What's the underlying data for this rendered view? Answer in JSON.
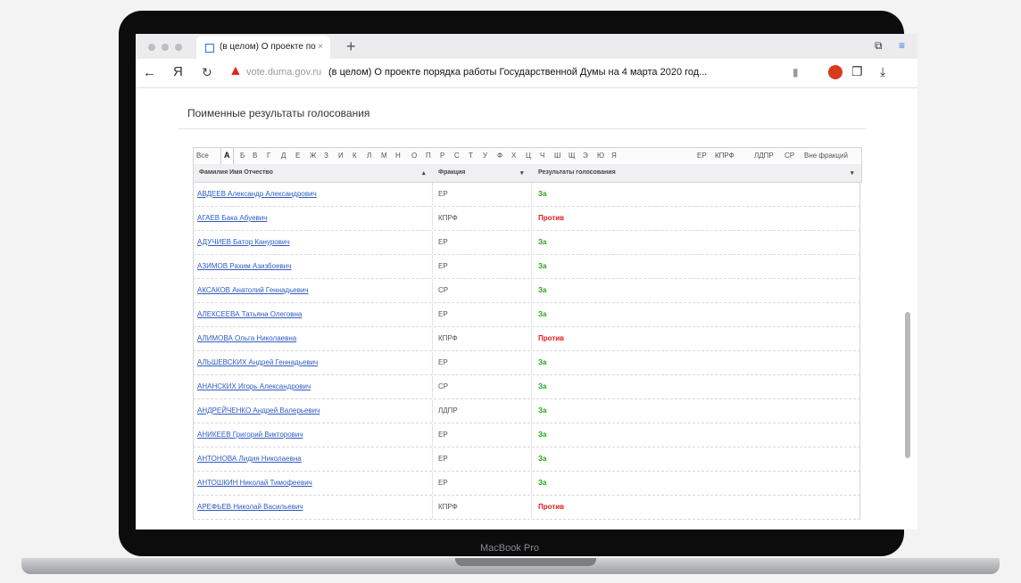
{
  "browser": {
    "tab_title": "(в целом) О проекте по",
    "tab_close": "×",
    "new_tab": "+",
    "yandex_letter": "Я",
    "domain": "vote.duma.gov.ru",
    "page_title": "(в целом) О проекте порядка работы Государственной Думы на 4 марта 2020 год..."
  },
  "device": {
    "label": "MacBook Pro"
  },
  "page": {
    "heading": "Поименные результаты голосования"
  },
  "letters": [
    "Все",
    "А",
    "Б",
    "В",
    "Г",
    "Д",
    "Е",
    "Ж",
    "З",
    "И",
    "К",
    "Л",
    "М",
    "Н",
    "О",
    "П",
    "Р",
    "С",
    "Т",
    "У",
    "Ф",
    "Х",
    "Ц",
    "Ч",
    "Ш",
    "Щ",
    "Э",
    "Ю",
    "Я"
  ],
  "factions_filter": [
    "ЕР",
    "КПРФ",
    "ЛДПР",
    "СР",
    "Вне фракций"
  ],
  "table": {
    "headers": {
      "name": "Фамилия Имя Отчество",
      "faction": "Фракция",
      "result": "Результаты голосования"
    },
    "rows": [
      {
        "name": "АВДЕЕВ Александр Александрович",
        "faction": "ЕР",
        "result": "За"
      },
      {
        "name": "АГАЕВ Бака Абуевич",
        "faction": "КПРФ",
        "result": "Против"
      },
      {
        "name": "АДУЧИЕВ Батор Канурович",
        "faction": "ЕР",
        "result": "За"
      },
      {
        "name": "АЗИМОВ Рахим Азизбоевич",
        "faction": "ЕР",
        "result": "За"
      },
      {
        "name": "АКСАКОВ Анатолий Геннадьевич",
        "faction": "СР",
        "result": "За"
      },
      {
        "name": "АЛЕКСЕЕВА Татьяна Олеговна",
        "faction": "ЕР",
        "result": "За"
      },
      {
        "name": "АЛИМОВА Ольга Николаевна",
        "faction": "КПРФ",
        "result": "Против"
      },
      {
        "name": "АЛЬШЕВСКИХ Андрей Геннадьевич",
        "faction": "ЕР",
        "result": "За"
      },
      {
        "name": "АНАНСКИХ Игорь Александрович",
        "faction": "СР",
        "result": "За"
      },
      {
        "name": "АНДРЕЙЧЕНКО Андрей Валерьевич",
        "faction": "ЛДПР",
        "result": "За"
      },
      {
        "name": "АНИКЕЕВ Григорий Викторович",
        "faction": "ЕР",
        "result": "За"
      },
      {
        "name": "АНТОНОВА Лидия Николаевна",
        "faction": "ЕР",
        "result": "За"
      },
      {
        "name": "АНТОШКИН Николай Тимофеевич",
        "faction": "ЕР",
        "result": "За"
      },
      {
        "name": "АРЕФЬЕВ Николай Васильевич",
        "faction": "КПРФ",
        "result": "Против"
      }
    ]
  },
  "colors": {
    "yes": "#2aa31a",
    "no": "#e41c1c",
    "link": "#2e5cc2"
  }
}
